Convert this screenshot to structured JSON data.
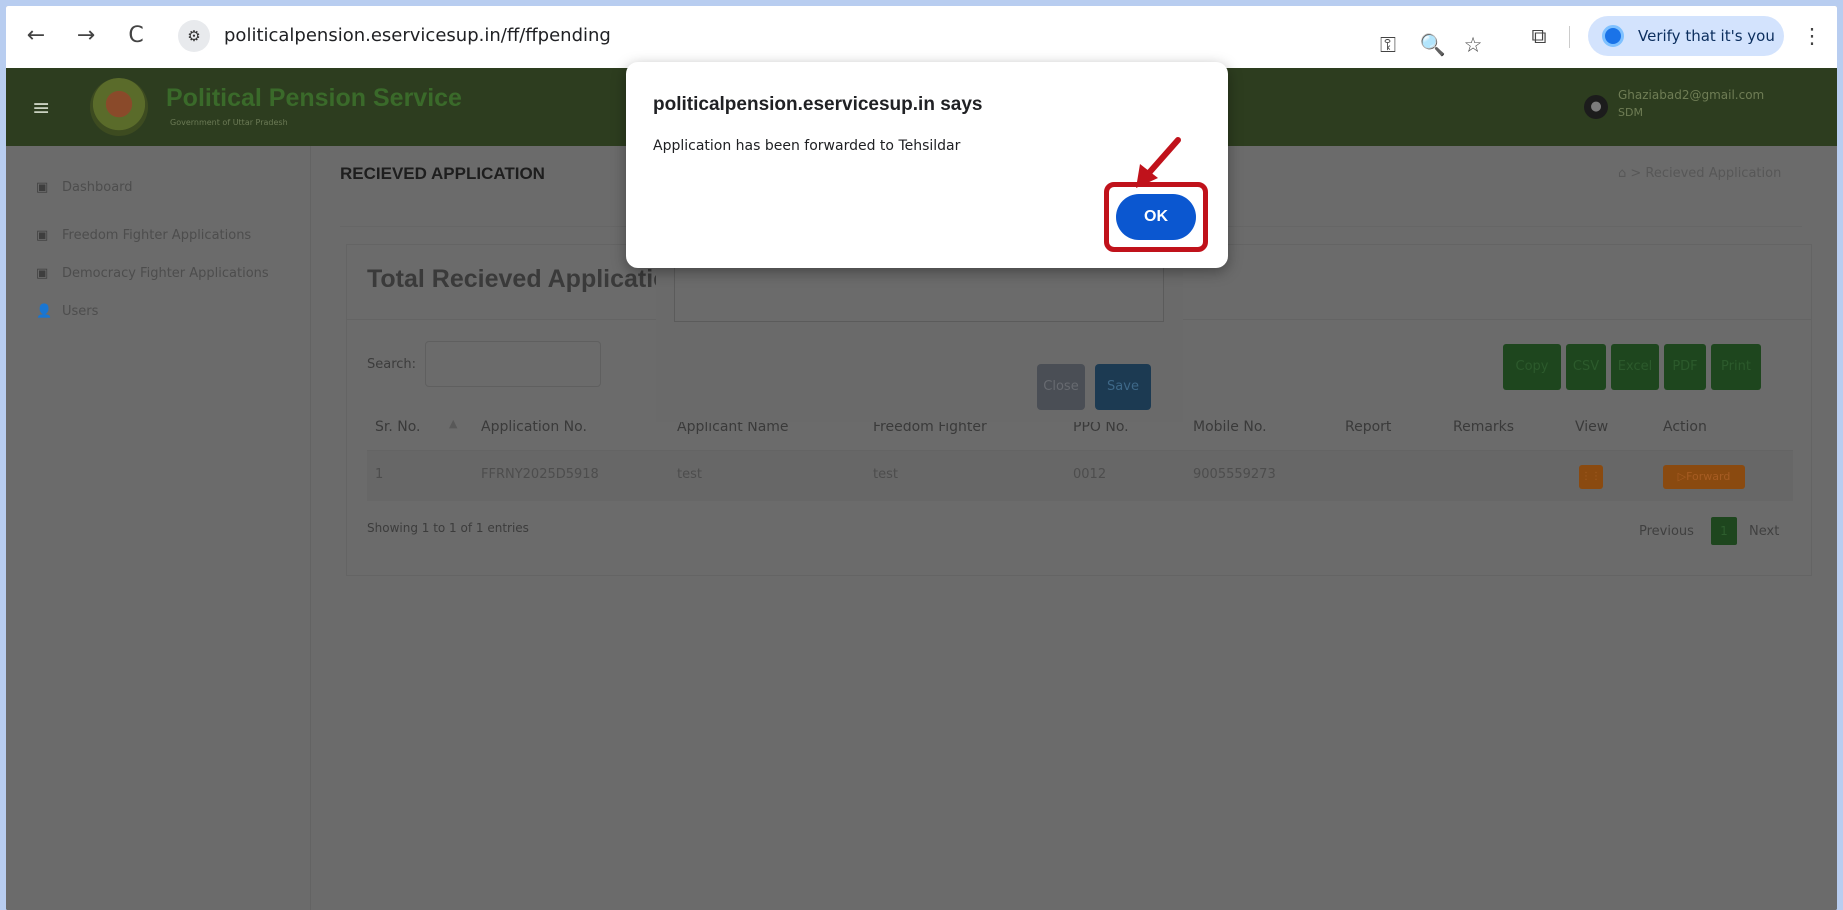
{
  "browser": {
    "url": "politicalpension.eservicesup.in/ff/ffpending",
    "verify_label": "Verify that it's you",
    "nav_back": "←",
    "nav_forward": "→",
    "nav_reload": "C",
    "site_info": "⚙",
    "key_icon": "⚿",
    "zoom_icon": "🔍",
    "star_icon": "☆",
    "ext_icon": "⧉",
    "menu_icon": "⋮"
  },
  "app": {
    "title": "Political Pension Service",
    "subtitle": "Government of Uttar Pradesh",
    "user_email": "Ghaziabad2@gmail.com",
    "user_role": "SDM",
    "menu_icon": "≡"
  },
  "sidebar": {
    "items": [
      {
        "icon": "▣",
        "label": "Dashboard"
      },
      {
        "icon": "▣",
        "label": "Freedom Fighter Applications"
      },
      {
        "icon": "▣",
        "label": "Democracy Fighter Applications"
      },
      {
        "icon": "👤",
        "label": "Users"
      }
    ]
  },
  "page": {
    "heading": "RECIEVED APPLICATION",
    "breadcrumb": "⌂ > Recieved Application",
    "card_title": "Total Recieved Applications",
    "search_label": "Search:",
    "export_buttons": [
      "Copy",
      "CSV",
      "Excel",
      "PDF",
      "Print"
    ],
    "columns": [
      "Sr. No.",
      "Application No.",
      "Applicant Name",
      "Freedom Fighter",
      "PPO No.",
      "Mobile No.",
      "Report",
      "Remarks",
      "View",
      "Action"
    ],
    "rows": [
      {
        "sr": "1",
        "app_no": "FFRNY2025D5918",
        "name": "test",
        "fighter": "test",
        "ppo": "0012",
        "mobile": "9005559273",
        "report": "",
        "remarks": "",
        "view": "⋮⋮",
        "action": "▷Forward"
      }
    ],
    "showing": "Showing 1 to 1 of 1 entries",
    "prev": "Previous",
    "current_page": "1",
    "next": "Next"
  },
  "underlying_modal": {
    "close_label": "Close",
    "save_label": "Save"
  },
  "alert": {
    "title": "politicalpension.eservicesup.in says",
    "message": "Application has been forwarded to Tehsildar",
    "ok_label": "OK"
  },
  "colors": {
    "alert_ok": "#0b57d0",
    "highlight": "#c0121b",
    "verify_bg": "#d3e3fd"
  }
}
